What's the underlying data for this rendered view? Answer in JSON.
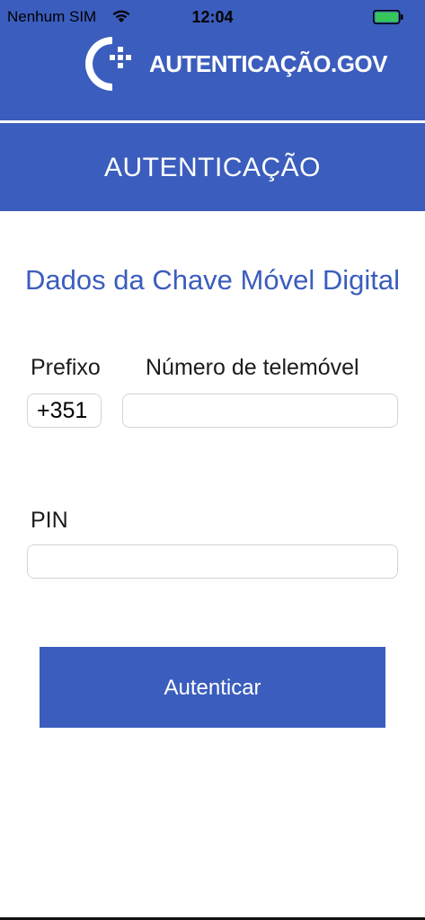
{
  "status_bar": {
    "carrier": "Nenhum SIM",
    "time": "12:04",
    "wifi_icon": "wifi-icon",
    "battery_icon": "battery-icon",
    "battery_level": 1.0,
    "battery_color": "#35c75a"
  },
  "header": {
    "logo_icon": "autenticacao-gov-logo-icon",
    "logo_text": "AUTENTICAÇÃO.GOV",
    "title": "AUTENTICAÇÃO"
  },
  "form": {
    "section_title": "Dados da Chave Móvel Digital",
    "prefix_label": "Prefixo",
    "prefix_value": "+351",
    "phone_label": "Número de telemóvel",
    "phone_value": "",
    "pin_label": "PIN",
    "pin_value": ""
  },
  "actions": {
    "submit_label": "Autenticar"
  },
  "colors": {
    "brand_blue": "#3b5dbd",
    "background": "#ffffff"
  }
}
